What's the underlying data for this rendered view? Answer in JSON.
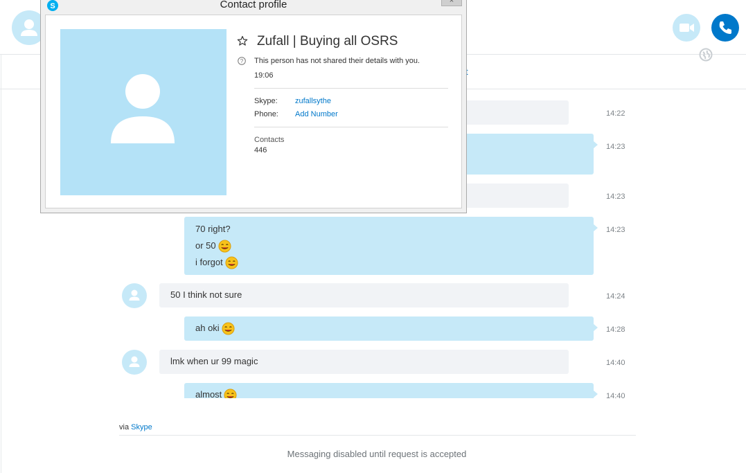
{
  "window": {
    "background_link_fragment": "t"
  },
  "dialog": {
    "title": "Contact profile",
    "close_glyph": "×",
    "name": "Zufall | Buying all OSRS",
    "privacy_note": "This person has not shared their details with you.",
    "local_time": "19:06",
    "skype_label": "Skype:",
    "skype_value": "zufallsythe",
    "phone_label": "Phone:",
    "phone_value": "Add Number",
    "contacts_label": "Contacts",
    "contacts_count": "446"
  },
  "messages": [
    {
      "direction": "in",
      "lines": [],
      "time": "14:22"
    },
    {
      "direction": "out",
      "lines": [],
      "time": "14:23"
    },
    {
      "direction": "in",
      "lines": [],
      "time": "14:23"
    },
    {
      "direction": "out",
      "lines": [
        {
          "text": "70 right?",
          "emoji": false
        },
        {
          "text": "or 50",
          "emoji": true
        },
        {
          "text": "i forgot",
          "emoji": true
        }
      ],
      "time": "14:23"
    },
    {
      "direction": "in",
      "lines": [
        {
          "text": "50 I think not sure",
          "emoji": false
        }
      ],
      "time": "14:24"
    },
    {
      "direction": "out",
      "lines": [
        {
          "text": "ah oki",
          "emoji": true
        }
      ],
      "time": "14:28"
    },
    {
      "direction": "in",
      "lines": [
        {
          "text": "lmk when ur 99 magic",
          "emoji": false
        }
      ],
      "time": "14:40"
    },
    {
      "direction": "out",
      "lines": [
        {
          "text": "almost",
          "emoji": true
        }
      ],
      "time": "14:40"
    }
  ],
  "footer": {
    "via_prefix": "via",
    "via_link": "Skype",
    "disabled_text": "Messaging disabled until request is accepted"
  },
  "colors": {
    "accent": "#0078ca",
    "outgoing_bubble": "#c6e9f8",
    "incoming_bubble": "#f1f3f6",
    "photo_placeholder": "#b4e2f7"
  },
  "icons": [
    "skype-logo-icon",
    "close-icon",
    "star-icon",
    "question-icon",
    "person-icon",
    "video-icon",
    "phone-icon",
    "globe-icon",
    "emoji-icon"
  ]
}
